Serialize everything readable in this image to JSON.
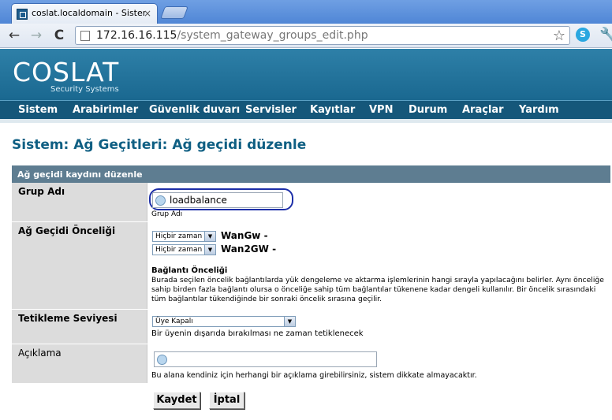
{
  "browser": {
    "tab_title": "coslat.localdomain - Sistem: A",
    "tab_close": "×",
    "url_host": "172.16.16.115",
    "url_path": "/system_gateway_groups_edit.php",
    "back_icon": "←",
    "forward_icon": "→",
    "reload_icon": "C",
    "star_icon": "☆",
    "wrench_icon": "🔧"
  },
  "header": {
    "logo": "COSLAT",
    "tagline": "Security Systems"
  },
  "nav": {
    "items": [
      "Sistem",
      "Arabirimler",
      "Güvenlik duvarı",
      "Servisler",
      "Kayıtlar",
      "VPN",
      "Durum",
      "Araçlar",
      "Yardım"
    ]
  },
  "page": {
    "title": "Sistem: Ağ Geçitleri: Ağ geçidi düzenle"
  },
  "form": {
    "header": "Ağ geçidi kaydını düzenle",
    "group_name": {
      "label": "Grup Adı",
      "value": "loadbalance",
      "hint": "Grup Adı"
    },
    "priority": {
      "label": "Ağ Geçidi Önceliği",
      "gateways": [
        {
          "select": "Hiçbir zaman",
          "name": "WanGw",
          "suffix": "-"
        },
        {
          "select": "Hiçbir zaman",
          "name": "Wan2GW",
          "suffix": "-"
        }
      ],
      "subhead": "Bağlantı Önceliği",
      "description": "Burada seçilen öncelik bağlantılarda yük dengeleme ve aktarma işlemlerinin hangi sırayla yapılacağını belirler. Aynı önceliğe sahip birden fazla bağlantı olursa o önceliğe sahip tüm bağlantılar tükenene kadar dengeli kullanılır. Bir öncelik sırasındaki tüm bağlantılar tükendiğinde bir sonraki öncelik sırasına geçilir."
    },
    "trigger": {
      "label": "Tetikleme Seviyesi",
      "select": "Üye Kapalı",
      "hint": "Bir üyenin dışarıda bırakılması ne zaman tetiklenecek"
    },
    "description": {
      "label": "Açıklama",
      "value": "",
      "hint": "Bu alana kendiniz için herhangi bir açıklama girebilirsiniz, sistem dikkate almayacaktır."
    },
    "buttons": {
      "save": "Kaydet",
      "cancel": "İptal"
    }
  }
}
